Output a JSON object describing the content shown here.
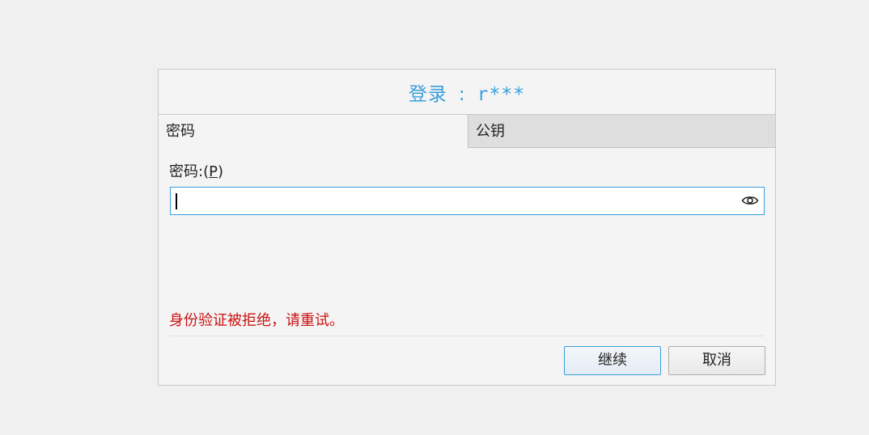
{
  "dialog": {
    "title_prefix": "登录",
    "title_separator": ":",
    "title_user": "r***",
    "accent_color": "#3a9fdd",
    "error_color": "#cc1111"
  },
  "tabs": [
    {
      "label": "密码",
      "active": true
    },
    {
      "label": "公钥",
      "active": false
    }
  ],
  "password": {
    "label": "密码:(",
    "mnemonic": "P",
    "label_end": ")",
    "value": "",
    "placeholder": "",
    "toggle_icon": "eye-icon"
  },
  "error_message": "身份验证被拒绝，请重试。",
  "buttons": {
    "continue_label": "继续",
    "cancel_label": "取消"
  }
}
